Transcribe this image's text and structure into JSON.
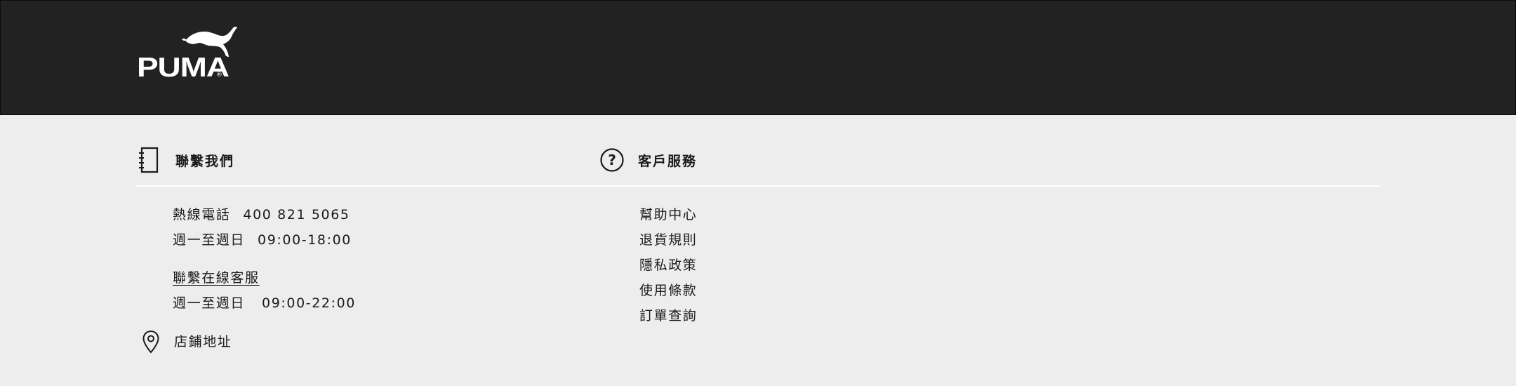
{
  "brand": {
    "logo_text": "PUMA",
    "registered_mark": "®"
  },
  "contact": {
    "heading": "聯繫我們",
    "icon": "notebook-icon",
    "hotline_label": "熱線電話",
    "hotline_number": "400 821 5065",
    "hotline_days": "週一至週日",
    "hotline_hours": "09:00-18:00",
    "online_service_link": "聯繫在線客服",
    "online_days": "週一至週日",
    "online_hours": "09:00-22:00",
    "store_icon": "location-pin-icon",
    "store_link": "店鋪地址"
  },
  "customer_service": {
    "heading": "客戶服務",
    "icon": "question-circle-icon",
    "links": [
      "幫助中心",
      "退貨規則",
      "隱私政策",
      "使用條款",
      "訂單查詢"
    ]
  },
  "colors": {
    "topbar": "#222222",
    "footer_bg": "#ededed",
    "text": "#1a1a1a"
  }
}
